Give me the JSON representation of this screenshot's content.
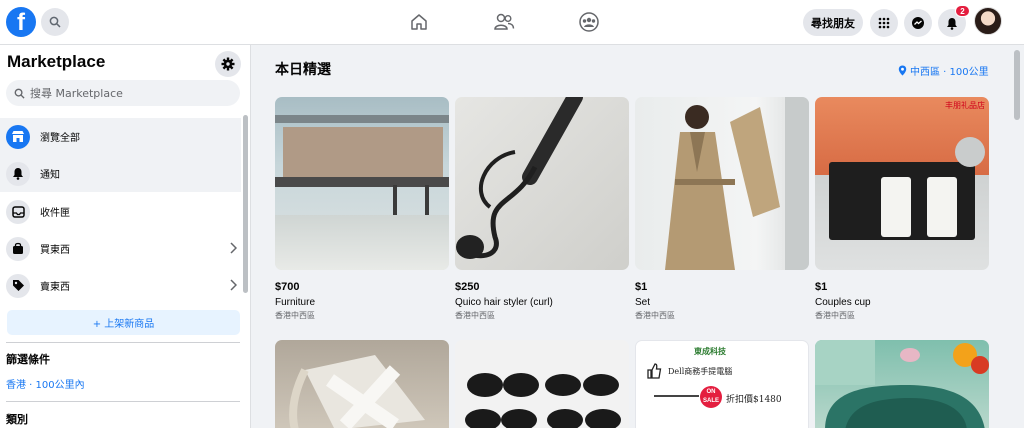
{
  "header": {
    "find_friends": "尋找朋友",
    "notification_count": "2"
  },
  "sidebar": {
    "title": "Marketplace",
    "search_placeholder": "搜尋 Marketplace",
    "items": [
      {
        "label": "瀏覽全部",
        "icon": "storefront-icon"
      },
      {
        "label": "通知",
        "icon": "bell-icon"
      },
      {
        "label": "收件匣",
        "icon": "inbox-icon"
      },
      {
        "label": "買東西",
        "icon": "shopping-bag-icon"
      },
      {
        "label": "賣東西",
        "icon": "tag-icon"
      }
    ],
    "create_listing": "+ 上架新商品",
    "filters_title": "篩選條件",
    "filter_value": "香港 · 100公里內",
    "category_title": "類別"
  },
  "main": {
    "title": "本日精選",
    "location": "中西區 · 100公里",
    "listings": [
      {
        "price": "$700",
        "title": "Furniture",
        "location": "香港中西區"
      },
      {
        "price": "$250",
        "title": "Quico hair styler (curl)",
        "location": "香港中西區"
      },
      {
        "price": "$1",
        "title": "Set",
        "location": "香港中西區"
      },
      {
        "price": "$1",
        "title": "Couples cup",
        "location": "香港中西區"
      }
    ],
    "shop_tag": "丰朋礼品店",
    "second_row": {
      "card3_brand": "東成科技",
      "card3_text1": "Dell商務手提電腦",
      "card3_text2": "折扣價$1480",
      "card3_sale_top": "ON",
      "card3_sale_bottom": "SALE"
    }
  },
  "colors": {
    "accent": "#1877f2",
    "badge": "#e41e3f",
    "background": "#f0f2f5"
  }
}
